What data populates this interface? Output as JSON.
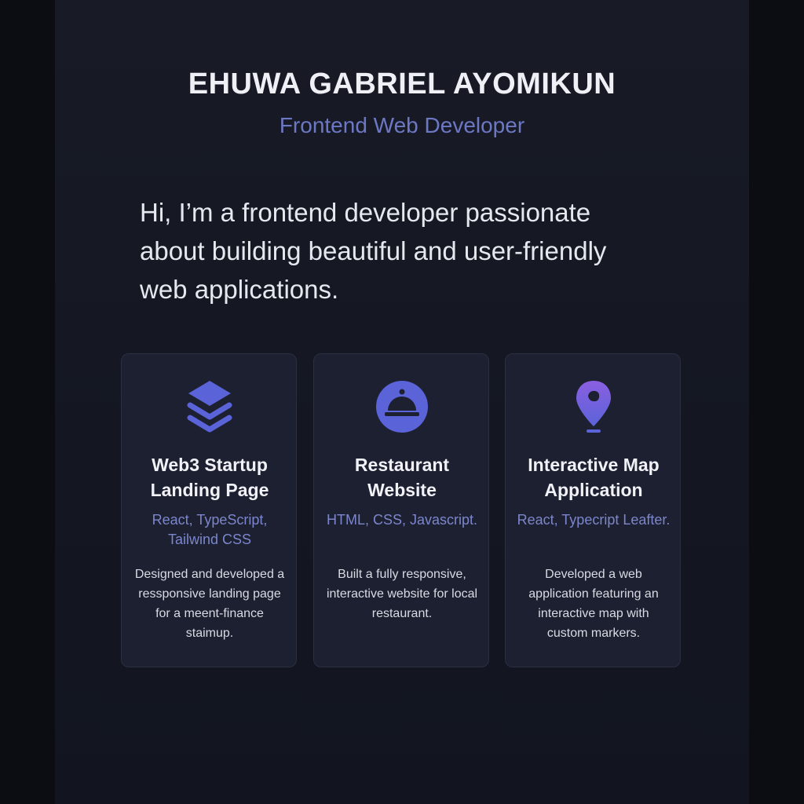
{
  "header": {
    "name": "EHUWA GABRIEL AYOMIKUN",
    "role": "Frontend Web Developer"
  },
  "intro": {
    "text": "Hi, I’m a frontend developer passionate about building beautiful and user-friendly web applications."
  },
  "colors": {
    "accent": "#6d78c4",
    "icon": "#5b63d9",
    "background": "#161923",
    "card": "#1c2030"
  },
  "projects": [
    {
      "icon": "layers-icon",
      "title": "Web3 Startup Landing Page",
      "tech": "React, TypeScript, Tailwind CSS",
      "description": "Designed and developed a ressponsive landing page for a meent-finance staimup."
    },
    {
      "icon": "cloche-icon",
      "title": "Restaurant Website",
      "tech": "HTML, CSS, Javascript.",
      "description": "Built a fully responsive, interactive website for local restaurant."
    },
    {
      "icon": "map-pin-icon",
      "title": "Interactive Map Application",
      "tech": "React, Typecript Leafter.",
      "description": "Developed a web application featuring an interactive map with custom markers."
    }
  ]
}
